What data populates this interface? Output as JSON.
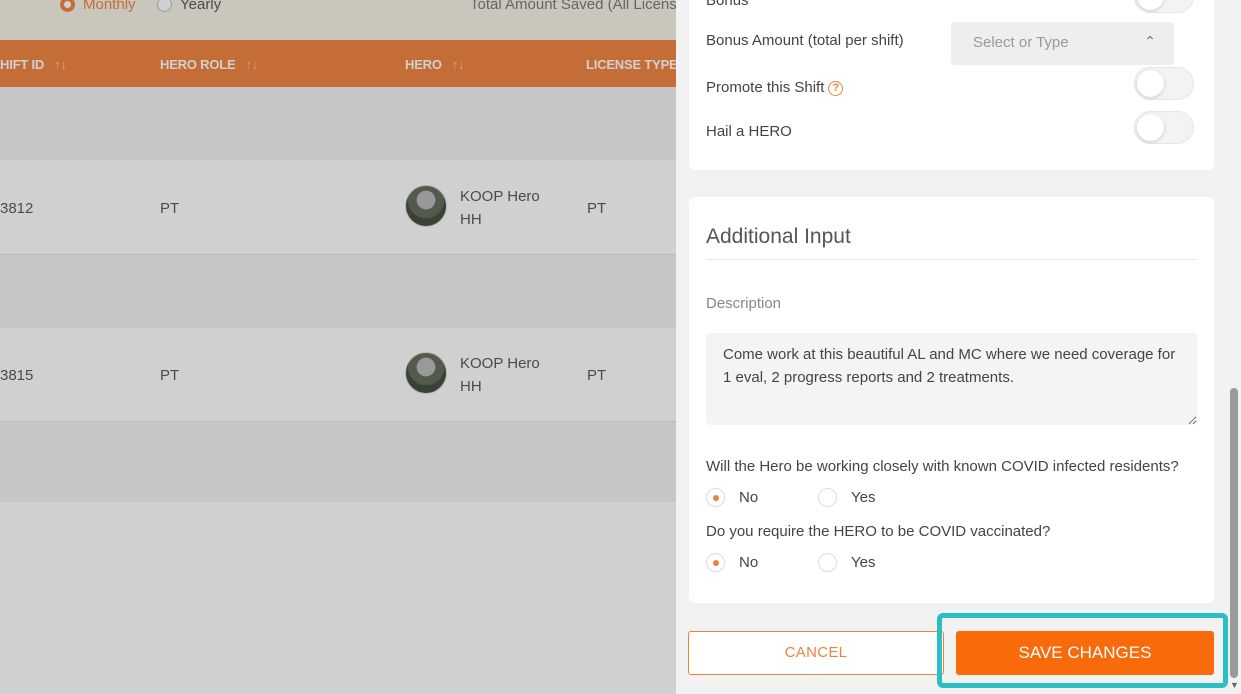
{
  "background": {
    "period_options": [
      {
        "label": "Monthly",
        "selected": true
      },
      {
        "label": "Yearly",
        "selected": false
      }
    ],
    "total_saved_label": "Total Amount Saved (All Licens",
    "table": {
      "columns": [
        "HIFT ID",
        "HERO ROLE",
        "HERO",
        "LICENSE TYPE"
      ],
      "sort_glyph": "↑↓",
      "rows": [
        {
          "shift_id": "3812",
          "role": "PT",
          "hero_line1": "KOOP Hero",
          "hero_line2": "HH",
          "license": "PT"
        },
        {
          "shift_id": "3815",
          "role": "PT",
          "hero_line1": "KOOP Hero",
          "hero_line2": "HH",
          "license": "PT"
        }
      ]
    }
  },
  "drawer": {
    "bonus_label": "Bonus",
    "bonus_amount_label": "Bonus Amount (total per shift)",
    "bonus_amount_placeholder": "Select or Type",
    "promote_label": "Promote this Shift",
    "hail_label": "Hail a HERO",
    "additional": {
      "title": "Additional Input",
      "description_label": "Description",
      "description_value": "Come work at this beautiful AL and MC where we need coverage for 1 eval, 2 progress reports and 2 treatments.",
      "q1": "Will the Hero be working closely with known COVID infected residents?",
      "q2": "Do you require the HERO to be COVID vaccinated?",
      "option_no": "No",
      "option_yes": "Yes",
      "q1_selected": "No",
      "q2_selected": "No"
    },
    "cancel_label": "CANCEL",
    "save_label": "SAVE CHANGES"
  },
  "colors": {
    "accent": "#f0803c",
    "save_button": "#f96a0a",
    "highlight": "#2bbfc4"
  }
}
